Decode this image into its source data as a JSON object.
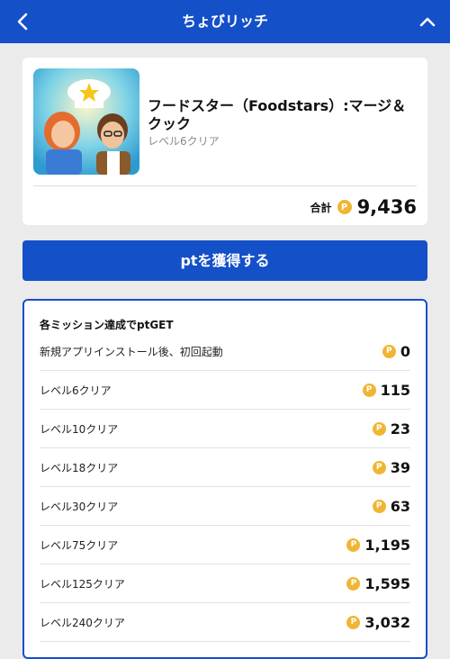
{
  "header": {
    "title": "ちょびリッチ"
  },
  "app": {
    "title": "フードスター（Foodstars）:マージ＆クック",
    "subtitle": "レベル6クリア",
    "total_label": "合計",
    "total_value": "9,436"
  },
  "coin_symbol": "P",
  "cta": {
    "label": "ptを獲得する"
  },
  "missions": {
    "heading": "各ミッション達成でptGET",
    "items": [
      {
        "name": "新規アプリインストール後、初回起動",
        "points": "0"
      },
      {
        "name": "レベル6クリア",
        "points": "115"
      },
      {
        "name": "レベル10クリア",
        "points": "23"
      },
      {
        "name": "レベル18クリア",
        "points": "39"
      },
      {
        "name": "レベル30クリア",
        "points": "63"
      },
      {
        "name": "レベル75クリア",
        "points": "1,195"
      },
      {
        "name": "レベル125クリア",
        "points": "1,595"
      },
      {
        "name": "レベル240クリア",
        "points": "3,032"
      }
    ]
  },
  "colors": {
    "brand": "#1450c8",
    "coin": "#f0b533",
    "background": "#ebebeb"
  },
  "icons": {
    "back": "chevron-left-icon",
    "collapse": "chevron-up-icon",
    "points": "coin-icon"
  }
}
